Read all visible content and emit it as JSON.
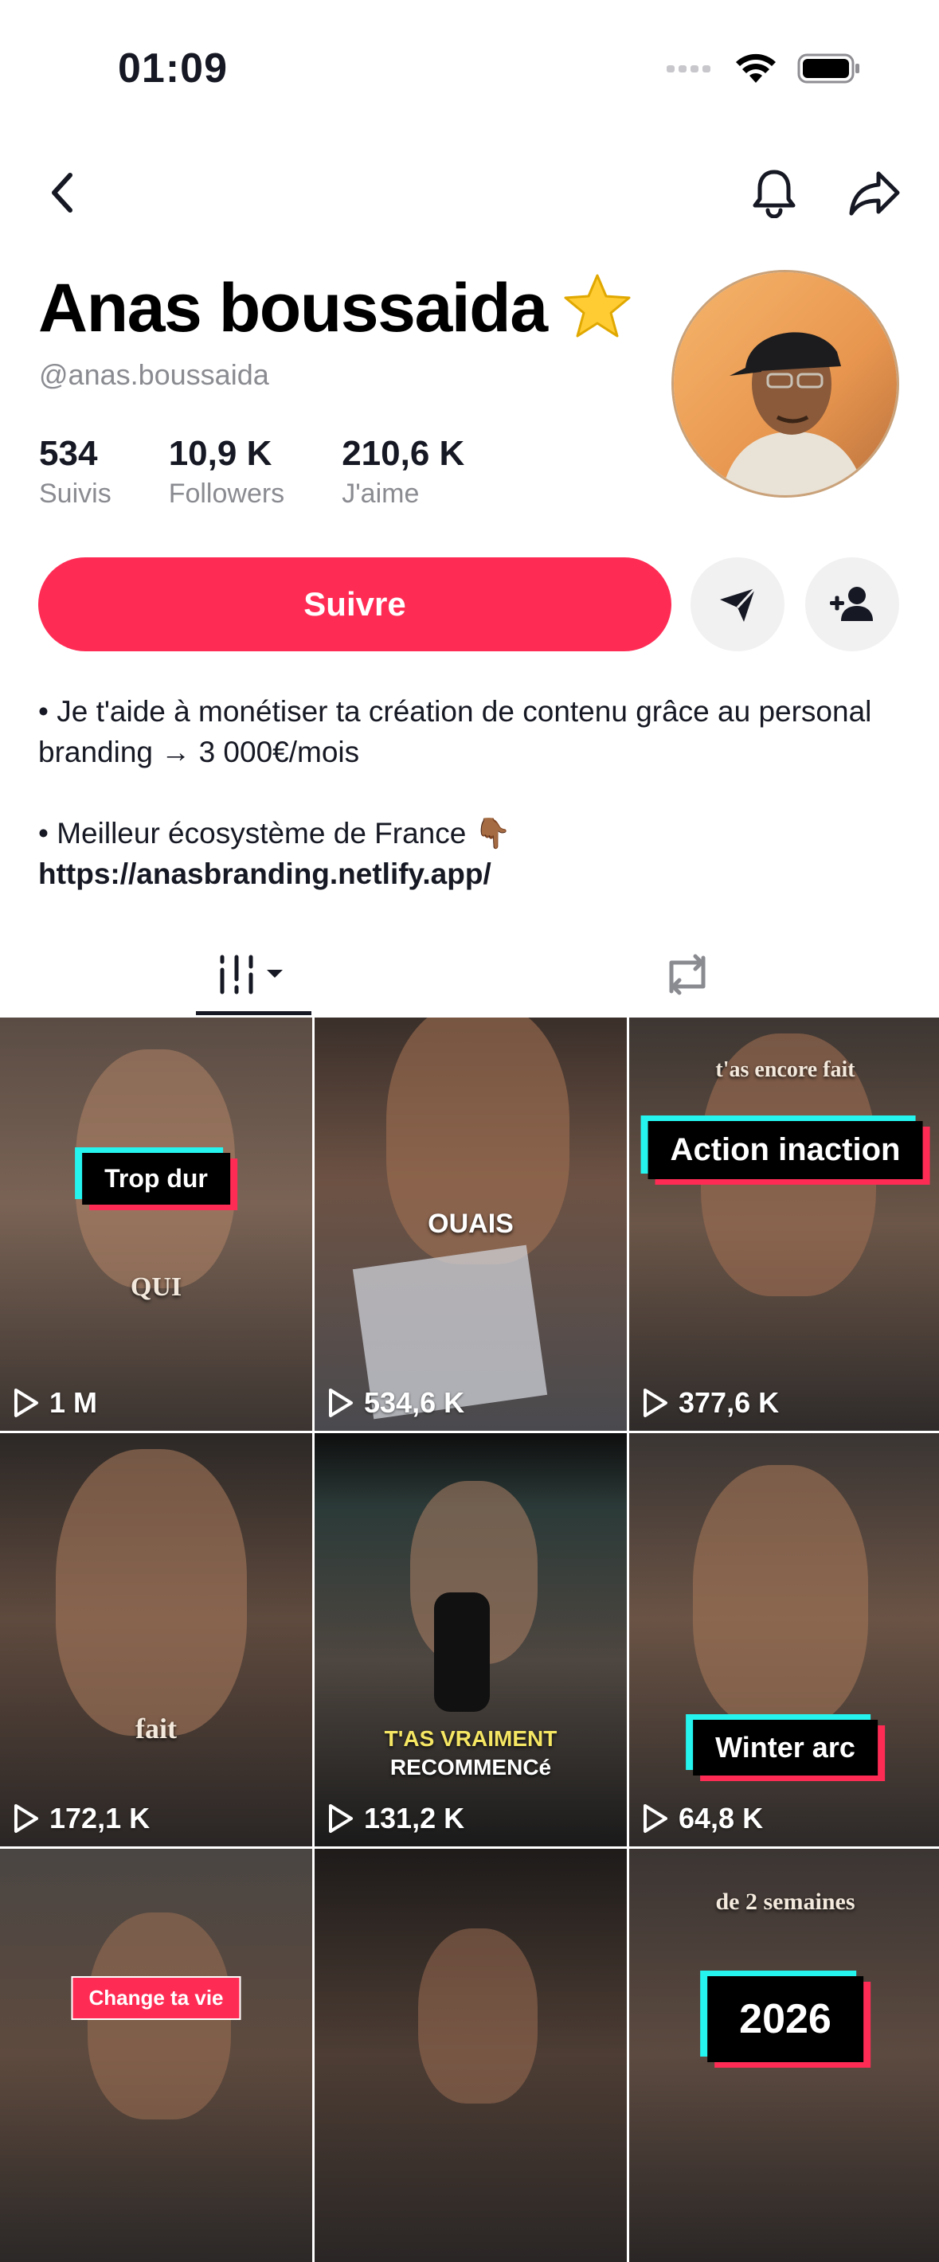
{
  "status_bar": {
    "time": "01:09"
  },
  "profile": {
    "display_name": "Anas boussaida",
    "badge_emoji": "⭐",
    "username": "@anas.boussaida",
    "stats": [
      {
        "value": "534",
        "label": "Suivis"
      },
      {
        "value": "10,9 K",
        "label": "Followers"
      },
      {
        "value": "210,6 K",
        "label": "J'aime"
      }
    ]
  },
  "actions": {
    "follow_label": "Suivre"
  },
  "bio": {
    "line1": "• Je t'aide à monétiser ta création de contenu grâce au personal branding → 3 000€/mois",
    "line2": "• Meilleur écosystème de France 👇🏾",
    "link": "https://anasbranding.netlify.app/"
  },
  "colors": {
    "accent": "#fe2c55",
    "cyan": "#25f4ee",
    "text": "#161823",
    "muted": "#8a8b91"
  },
  "videos": [
    {
      "views": "1 M",
      "caption": "Trop dur",
      "caption2": "QUI"
    },
    {
      "views": "534,6 K",
      "caption": "OUAIS"
    },
    {
      "views": "377,6 K",
      "caption": "t'as encore fait",
      "caption2": "Action inaction"
    },
    {
      "views": "172,1 K",
      "caption": "fait"
    },
    {
      "views": "131,2 K",
      "caption": "T'AS VRAIMENT",
      "caption2": "RECOMMENCé"
    },
    {
      "views": "64,8 K",
      "caption": "Winter arc"
    },
    {
      "views": "",
      "caption": "Change ta vie"
    },
    {
      "views": "",
      "caption": ""
    },
    {
      "views": "",
      "caption": "de 2 semaines",
      "caption2": "2026"
    }
  ]
}
